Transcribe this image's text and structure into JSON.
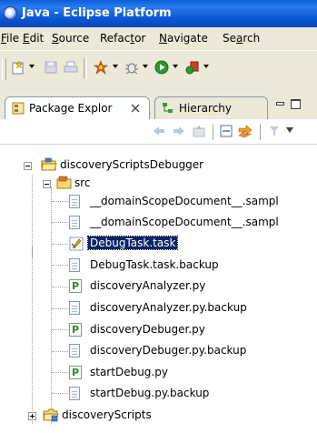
{
  "window": {
    "title": "Java - Eclipse Platform"
  },
  "menu": {
    "items": [
      {
        "mnemonic": "F",
        "rest": "ile"
      },
      {
        "mnemonic": "E",
        "rest": "dit"
      },
      {
        "mnemonic": "S",
        "rest": "ource"
      },
      {
        "pre": "Refac",
        "mnemonic": "t",
        "rest": "or"
      },
      {
        "mnemonic": "N",
        "rest": "avigate"
      },
      {
        "pre": "Se",
        "mnemonic": "a",
        "rest": "rch"
      }
    ]
  },
  "toolbar": {
    "icons": [
      "new-wizard-icon",
      "save-icon",
      "print-icon",
      "new-java-project-icon",
      "debug-icon",
      "run-icon",
      "run-external-icon"
    ]
  },
  "tabs": [
    {
      "label": "Package Explor",
      "icon": "package-explorer-icon",
      "active": true
    },
    {
      "label": "Hierarchy",
      "icon": "hierarchy-icon",
      "active": false
    }
  ],
  "tree": {
    "project": "discoveryScriptsDebugger",
    "src_folder": "src",
    "files": [
      {
        "name": "__domainScopeDocument__.sampl",
        "type": "file"
      },
      {
        "name": "__domainScopeDocument__.sampl",
        "type": "file"
      },
      {
        "name": "DebugTask.task",
        "type": "task",
        "selected": true
      },
      {
        "name": "DebugTask.task.backup",
        "type": "file"
      },
      {
        "name": "discoveryAnalyzer.py",
        "type": "py"
      },
      {
        "name": "discoveryAnalyzer.py.backup",
        "type": "file"
      },
      {
        "name": "discoveryDebuger.py",
        "type": "py"
      },
      {
        "name": "discoveryDebuger.py.backup",
        "type": "file"
      },
      {
        "name": "startDebug.py",
        "type": "py"
      },
      {
        "name": "startDebug.py.backup",
        "type": "file"
      }
    ],
    "second_project": "discoveryScripts"
  },
  "colors": {
    "title_bar": "#0a5fd8",
    "selection": "#0a246a",
    "chrome": "#ece9d8"
  }
}
